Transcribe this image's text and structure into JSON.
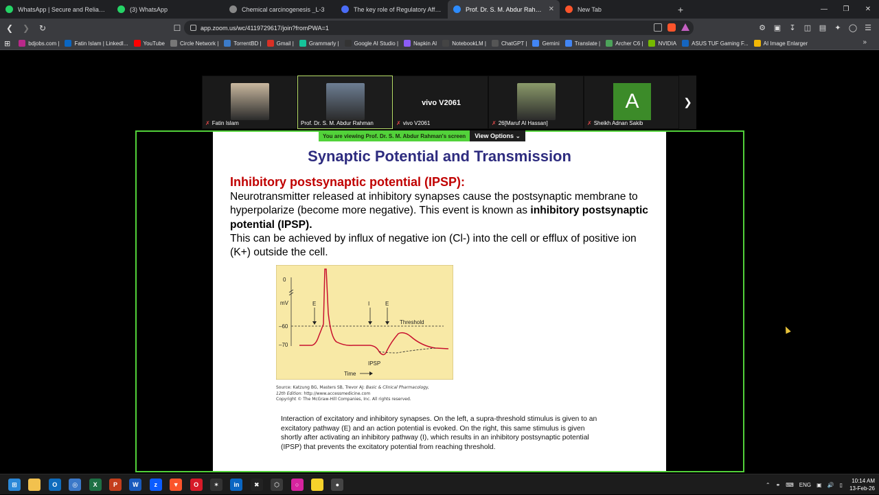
{
  "browser": {
    "tabs": [
      {
        "label": "WhatsApp | Secure and Reliable Free",
        "color": "#25d366",
        "active": false
      },
      {
        "label": "(3) WhatsApp",
        "color": "#25d366",
        "active": false
      },
      {
        "label": "Chemical carcinogenesis _L-3",
        "color": "#888888",
        "active": false
      },
      {
        "label": "The key role of Regulatory Affairs in",
        "color": "#4a6cf7",
        "active": false
      },
      {
        "label": "Prof. Dr. S. M. Abdur Rahman",
        "color": "#2d8cff",
        "active": true
      },
      {
        "label": "New Tab",
        "color": "#fb542b",
        "active": false
      }
    ],
    "new_tab_symbol": "+",
    "url": "app.zoom.us/wc/4119729617/join?fromPWA=1",
    "bookmarks": [
      {
        "label": "bdjobs.com |",
        "color": "#b9288a"
      },
      {
        "label": "Fatin Islam | LinkedI...",
        "color": "#0a66c2"
      },
      {
        "label": "YouTube",
        "color": "#ff0000"
      },
      {
        "label": "Circle Network |",
        "color": "#777777"
      },
      {
        "label": "TorrentBD |",
        "color": "#3c7bc9"
      },
      {
        "label": "Gmail |",
        "color": "#d93025"
      },
      {
        "label": "Grammarly |",
        "color": "#15c39a"
      },
      {
        "label": "Google AI Studio |",
        "color": "#333333"
      },
      {
        "label": "Napkin AI",
        "color": "#8b5cf6"
      },
      {
        "label": "NotebookLM |",
        "color": "#444444"
      },
      {
        "label": "ChatGPT |",
        "color": "#555555"
      },
      {
        "label": "Gemini",
        "color": "#4285f4"
      },
      {
        "label": "Translate |",
        "color": "#4285f4"
      },
      {
        "label": "Archer C6 |",
        "color": "#4ca35a"
      },
      {
        "label": "NVIDIA",
        "color": "#76b900"
      },
      {
        "label": "ASUS TUF Gaming F...",
        "color": "#1565c0"
      },
      {
        "label": "AI Image Enlarger",
        "color": "#f2b705"
      }
    ]
  },
  "zoom": {
    "participants": [
      {
        "name": "Fatin Islam",
        "type": "video",
        "avatar_color": "#c9b89f",
        "muted": true
      },
      {
        "name": "Prof. Dr. S. M. Abdur Rahman",
        "type": "video",
        "avatar_color": "#6d7e93",
        "muted": false,
        "active": true
      },
      {
        "name": "vivo V2061",
        "type": "name",
        "center_label": "vivo V2061",
        "muted": true
      },
      {
        "name": "26[Maruf Al Hassan]",
        "type": "video",
        "avatar_color": "#8b9a6a",
        "muted": true
      },
      {
        "name": "Sheikh Adnan Sakib",
        "type": "letter",
        "letter": "A",
        "muted": true
      }
    ],
    "banner_text": "You are viewing  Prof. Dr. S. M. Abdur Rahman's screen",
    "view_options": "View Options"
  },
  "slide": {
    "title": "Synaptic Potential and Transmission",
    "subtitle": "Inhibitory postsynaptic potential (IPSP):",
    "body_1": "Neurotransmitter released at inhibitory synapses cause the postsynaptic membrane to hyperpolarize (become more negative). This event is known as ",
    "body_1_bold": "inhibitory postsynaptic potential (IPSP).",
    "body_2": "This can be achieved by influx of negative ion (Cl-) into the cell or efflux of positive ion (K+) outside the cell.",
    "figure": {
      "y_top": "0",
      "unit": "mV",
      "y_mid": "–60",
      "y_low": "–70",
      "label_e1": "E",
      "label_i": "I",
      "label_e2": "E",
      "threshold": "Threshold",
      "ipsp": "IPSP",
      "time": "Time"
    },
    "source_1": "Source: Katzung BG, Masters SB, Trevor AJ: ",
    "source_1_italic": "Basic & Clinical Pharmacology,",
    "source_2_italic": "12th Edition",
    "source_2": ": http://www.accessmedicine.com",
    "copyright": "Copyright © The McGraw-Hill Companies, Inc. All rights reserved.",
    "caption": "Interaction of excitatory and inhibitory synapses. On the left, a supra-threshold stimulus is given to an excitatory pathway (E) and an action potential is evoked. On the right, this same stimulus is given shortly after activating an inhibitory pathway (I), which results in an inhibitory postsynaptic potential (IPSP) that prevents the excitatory potential from reaching threshold."
  },
  "taskbar": {
    "apps": [
      {
        "name": "windows-start",
        "color": "#2b88d8",
        "glyph": "⊞"
      },
      {
        "name": "file-explorer",
        "color": "#f2c14e",
        "glyph": ""
      },
      {
        "name": "outlook",
        "color": "#0f6cbd",
        "glyph": "O"
      },
      {
        "name": "app-blue",
        "color": "#3b78c8",
        "glyph": "◎"
      },
      {
        "name": "excel",
        "color": "#1d7044",
        "glyph": "X"
      },
      {
        "name": "powerpoint",
        "color": "#c43e1c",
        "glyph": "P"
      },
      {
        "name": "word",
        "color": "#185abd",
        "glyph": "W"
      },
      {
        "name": "zoom",
        "color": "#0b5cff",
        "glyph": "z"
      },
      {
        "name": "brave",
        "color": "#fb542b",
        "glyph": "▼"
      },
      {
        "name": "opera",
        "color": "#d71a28",
        "glyph": "O"
      },
      {
        "name": "chatgpt",
        "color": "#333333",
        "glyph": "✶"
      },
      {
        "name": "linkedin",
        "color": "#0a66c2",
        "glyph": "in"
      },
      {
        "name": "capcut",
        "color": "#222222",
        "glyph": "✖"
      },
      {
        "name": "app-dark",
        "color": "#3a3a3a",
        "glyph": "⬡"
      },
      {
        "name": "instagram",
        "color": "#d6249f",
        "glyph": "○"
      },
      {
        "name": "sticky-notes",
        "color": "#f6d22b",
        "glyph": ""
      },
      {
        "name": "app-record",
        "color": "#444444",
        "glyph": "●"
      }
    ],
    "lang": "ENG",
    "time": "10:14 AM",
    "date": "13-Feb-26"
  }
}
